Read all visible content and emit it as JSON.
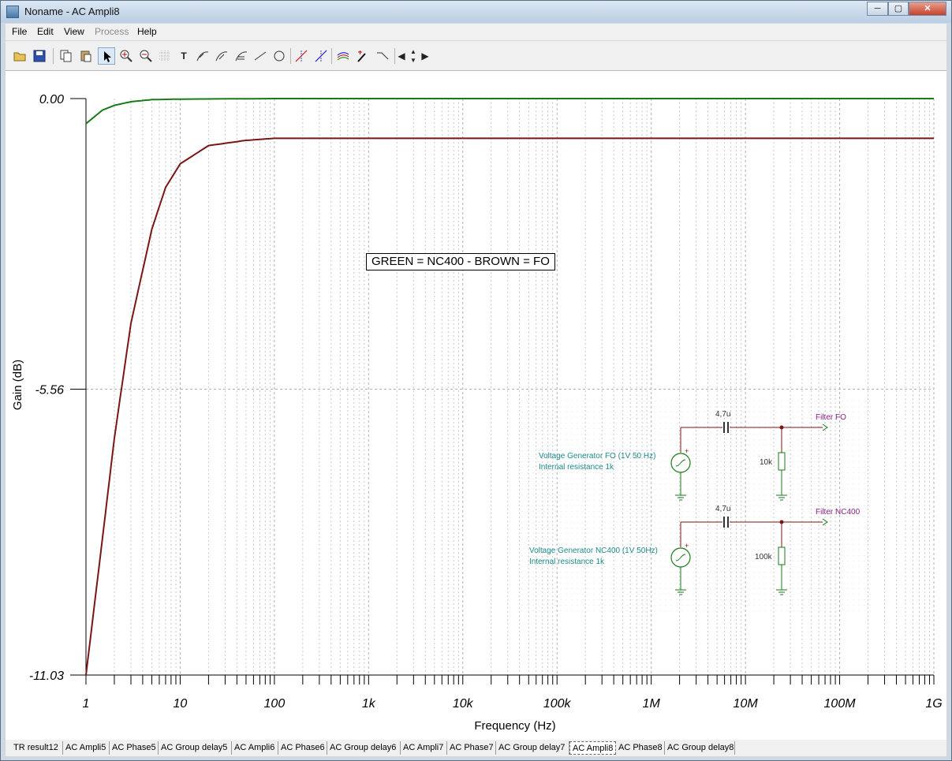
{
  "window": {
    "title": "Noname - AC Ampli8"
  },
  "menu": {
    "items": [
      "File",
      "Edit",
      "View",
      "Process",
      "Help"
    ]
  },
  "colors": {
    "green": "#1a7a1a",
    "brown": "#7a1616",
    "teal": "#1e8a8a",
    "purple": "#8a1f8a"
  },
  "chart_data": {
    "type": "line",
    "ylabel": "Gain (dB)",
    "xlabel": "Frequency (Hz)",
    "x_scale": "log",
    "xlim": [
      1,
      1000000000
    ],
    "ylim": [
      -11.03,
      0.0
    ],
    "ytick_labels": [
      "0.00",
      "-5.56",
      "-11.03"
    ],
    "yticks": [
      0.0,
      -5.56,
      -11.03
    ],
    "xtick_labels": [
      "1",
      "10",
      "100",
      "1k",
      "10k",
      "100k",
      "1M",
      "10M",
      "100M",
      "1G"
    ],
    "xticks": [
      1,
      10,
      100,
      1000,
      10000,
      100000,
      1000000,
      10000000,
      100000000,
      1000000000
    ],
    "grid": true,
    "annotation": "GREEN = NC400 - BROWN = FO",
    "series": [
      {
        "color": "#1a7a1a",
        "x": [
          1,
          1.5,
          2,
          3,
          5,
          10,
          100,
          1000000000
        ],
        "y": [
          -0.48,
          -0.22,
          -0.13,
          -0.06,
          -0.02,
          -0.01,
          0.0,
          0.0
        ]
      },
      {
        "color": "#7a1616",
        "x": [
          1,
          1.5,
          2,
          3,
          5,
          7,
          10,
          20,
          50,
          100,
          1000000000
        ],
        "y": [
          -11.03,
          -8.4,
          -6.5,
          -4.3,
          -2.5,
          -1.7,
          -1.25,
          -0.9,
          -0.8,
          -0.76,
          -0.76
        ]
      }
    ]
  },
  "schematic": {
    "cap_fo": "4,7u",
    "cap_nc": "4,7u",
    "filter_fo": "Filter FO",
    "filter_nc": "Filter NC400",
    "gen_fo": "Voltage Generator FO (1V 50 Hz)",
    "gen_fo_res": "Internal resistance 1k",
    "gen_nc": "Voltage Generator NC400 (1V 50Hz)",
    "gen_nc_res": "Internal resistance 1k",
    "res_fo": "10k",
    "res_nc": "100k"
  },
  "tabs": [
    "TR result12",
    "AC Ampli5",
    "AC Phase5",
    "AC Group delay5",
    "AC Ampli6",
    "AC Phase6",
    "AC Group delay6",
    "AC Ampli7",
    "AC Phase7",
    "AC Group delay7",
    "AC Ampli8",
    "AC Phase8",
    "AC Group delay8"
  ],
  "active_tab": "AC Ampli8"
}
